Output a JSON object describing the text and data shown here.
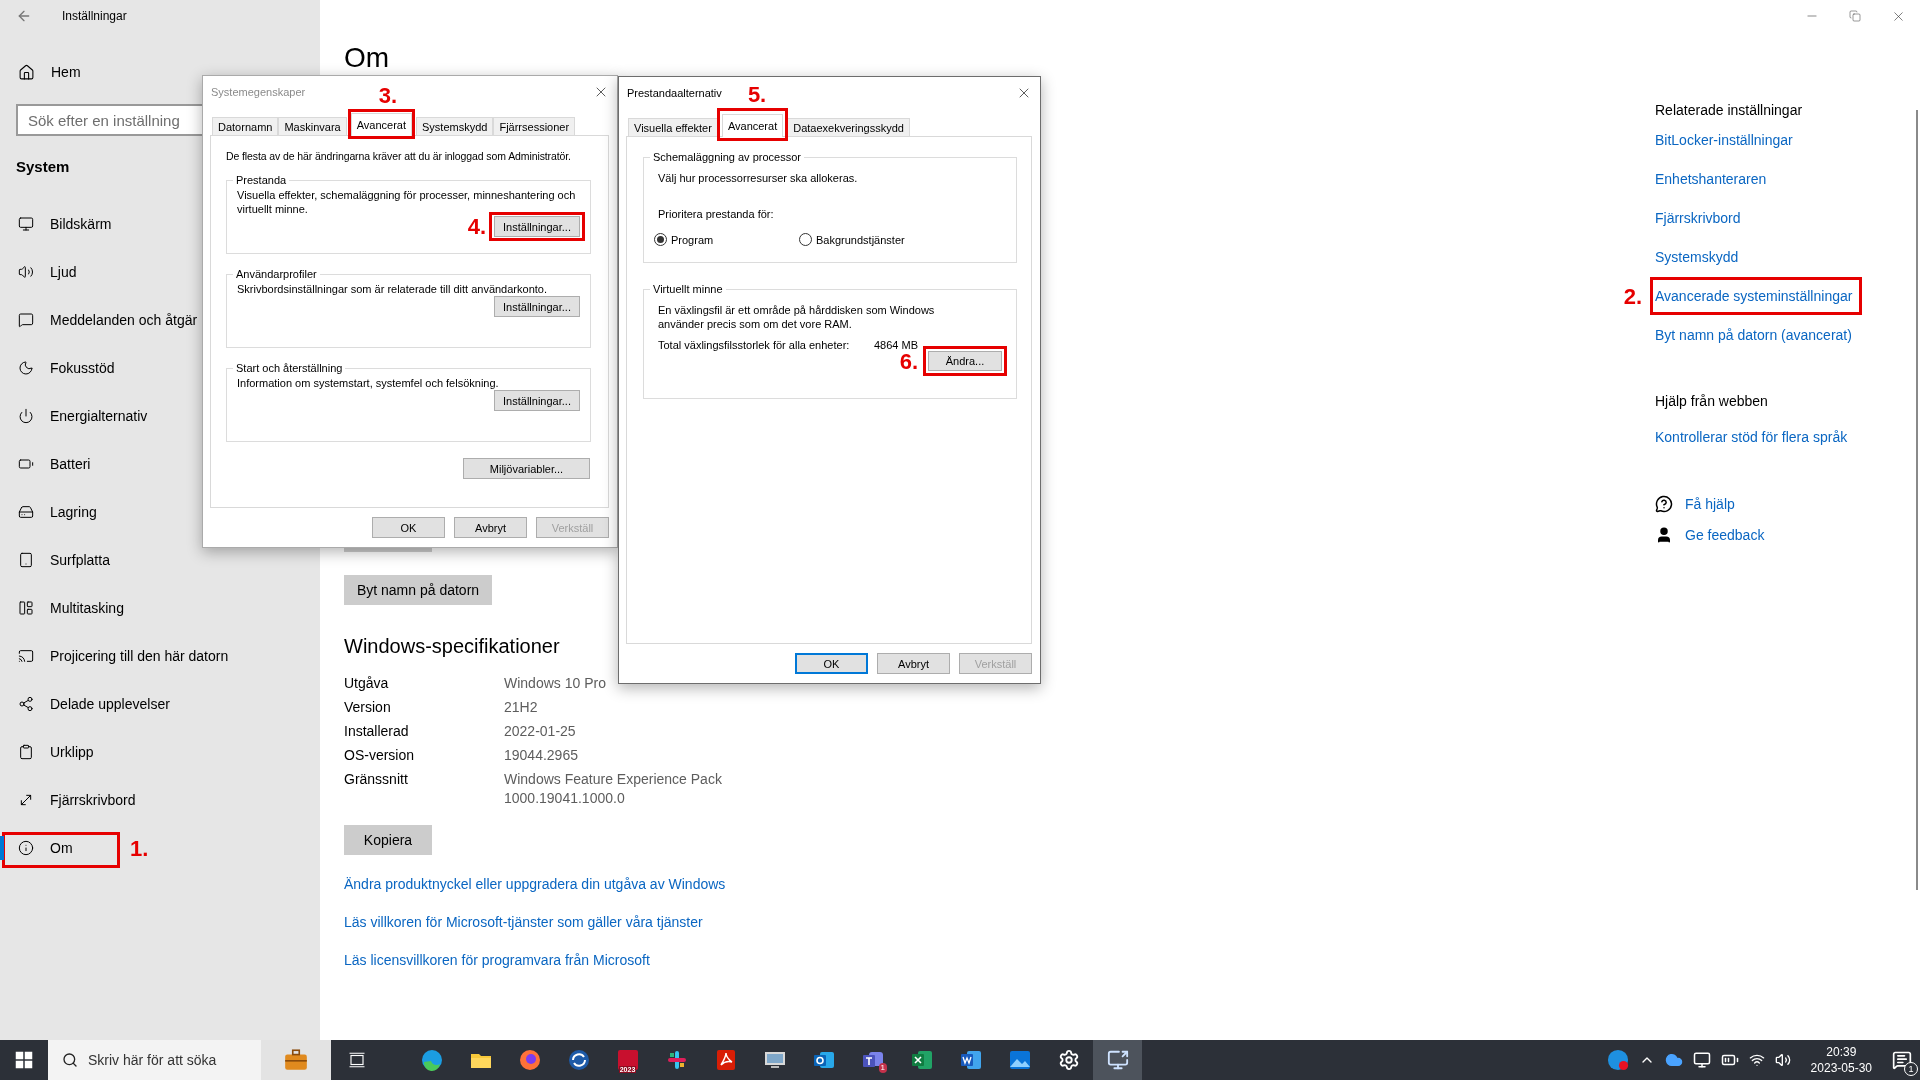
{
  "settings_window": {
    "title": "Inställningar"
  },
  "sidebar": {
    "home": "Hem",
    "search_placeholder": "Sök efter en inställning",
    "section": "System",
    "items": [
      {
        "label": "Bildskärm",
        "selected": false
      },
      {
        "label": "Ljud",
        "selected": false
      },
      {
        "label": "Meddelanden och åtgär",
        "selected": false
      },
      {
        "label": "Fokusstöd",
        "selected": false
      },
      {
        "label": "Energialternativ",
        "selected": false
      },
      {
        "label": "Batteri",
        "selected": false
      },
      {
        "label": "Lagring",
        "selected": false
      },
      {
        "label": "Surfplatta",
        "selected": false
      },
      {
        "label": "Multitasking",
        "selected": false
      },
      {
        "label": "Projicering till den här datorn",
        "selected": false
      },
      {
        "label": "Delade upplevelser",
        "selected": false
      },
      {
        "label": "Urklipp",
        "selected": false
      },
      {
        "label": "Fjärrskrivbord",
        "selected": false
      },
      {
        "label": "Om",
        "selected": true,
        "marker": "1."
      }
    ]
  },
  "main": {
    "title": "Om",
    "rename_button": "Byt namn på datorn",
    "specs": {
      "heading": "Windows-specifikationer",
      "rows": [
        {
          "label": "Utgåva",
          "value": "Windows 10 Pro"
        },
        {
          "label": "Version",
          "value": "21H2"
        },
        {
          "label": "Installerad",
          "value": "2022-01-25"
        },
        {
          "label": "OS-version",
          "value": "19044.2965"
        },
        {
          "label": "Gränssnitt",
          "value": "Windows Feature Experience Pack 1000.19041.1000.0"
        }
      ]
    },
    "copy_button": "Kopiera",
    "links": [
      "Ändra produktnyckel eller uppgradera din utgåva av Windows",
      "Läs villkoren för Microsoft-tjänster som gäller våra tjänster",
      "Läs licensvillkoren för programvara från Microsoft"
    ]
  },
  "related": {
    "heading": "Relaterade inställningar",
    "links": [
      {
        "label": "BitLocker-inställningar"
      },
      {
        "label": "Enhetshanteraren"
      },
      {
        "label": "Fjärrskrivbord"
      },
      {
        "label": "Systemskydd"
      },
      {
        "label": "Avancerade systeminställningar",
        "marker": "2."
      },
      {
        "label": "Byt namn på datorn (avancerat)"
      }
    ],
    "web_heading": "Hjälp från webben",
    "web_links": [
      "Kontrollerar stöd för flera språk"
    ],
    "support_links": [
      "Få hjälp",
      "Ge feedback"
    ]
  },
  "system_properties": {
    "title": "Systemegenskaper",
    "active": false,
    "tabs": [
      {
        "label": "Datornamn",
        "selected": false
      },
      {
        "label": "Maskinvara",
        "selected": false
      },
      {
        "label": "Avancerat",
        "selected": true,
        "marker": "3."
      },
      {
        "label": "Systemskydd",
        "selected": false
      },
      {
        "label": "Fjärrsessioner",
        "selected": false
      }
    ],
    "note": "De flesta av de här ändringarna kräver att du är inloggad som Administratör.",
    "groups": [
      {
        "title": "Prestanda",
        "text": "Visuella effekter, schemaläggning för processer, minneshantering och virtuellt minne.",
        "button": {
          "label": "Inställningar...",
          "marker": "4."
        }
      },
      {
        "title": "Användarprofiler",
        "text": "Skrivbordsinställningar som är relaterade till ditt användarkonto.",
        "button": {
          "label": "Inställningar..."
        }
      },
      {
        "title": "Start och återställning",
        "text": "Information om systemstart, systemfel och felsökning.",
        "button": {
          "label": "Inställningar..."
        }
      }
    ],
    "env_button": "Miljövariabler...",
    "buttons": [
      {
        "label": "OK",
        "default": false,
        "disabled": false
      },
      {
        "label": "Avbryt",
        "default": false,
        "disabled": false
      },
      {
        "label": "Verkställ",
        "default": false,
        "disabled": true
      }
    ]
  },
  "performance_options": {
    "title": "Prestandaalternativ",
    "active": true,
    "tabs": [
      {
        "label": "Visuella effekter",
        "selected": false
      },
      {
        "label": "Avancerat",
        "selected": true,
        "marker": "5."
      },
      {
        "label": "Dataexekveringsskydd",
        "selected": false
      }
    ],
    "scheduling": {
      "title": "Schemaläggning av processor",
      "text": "Välj hur processorresurser ska allokeras.",
      "prompt": "Prioritera prestanda för:",
      "options": [
        {
          "label": "Program",
          "selected": true
        },
        {
          "label": "Bakgrundstjänster",
          "selected": false
        }
      ]
    },
    "virtual_memory": {
      "title": "Virtuellt minne",
      "text": "En växlingsfil är ett område på hårddisken som Windows använder precis som om det vore RAM.",
      "total_label": "Total växlingsfilsstorlek för alla enheter:",
      "total_value": "4864 MB",
      "button": {
        "label": "Ändra...",
        "marker": "6."
      }
    },
    "buttons": [
      {
        "label": "OK",
        "default": true,
        "disabled": false
      },
      {
        "label": "Avbryt",
        "default": false,
        "disabled": false
      },
      {
        "label": "Verkställ",
        "default": false,
        "disabled": true
      }
    ]
  },
  "taskbar": {
    "search_placeholder": "Skriv här för att söka",
    "cad_badge": "2023",
    "chat_badge": "1",
    "time": "20:39",
    "date": "2023-05-30",
    "notification_badge": "1"
  }
}
